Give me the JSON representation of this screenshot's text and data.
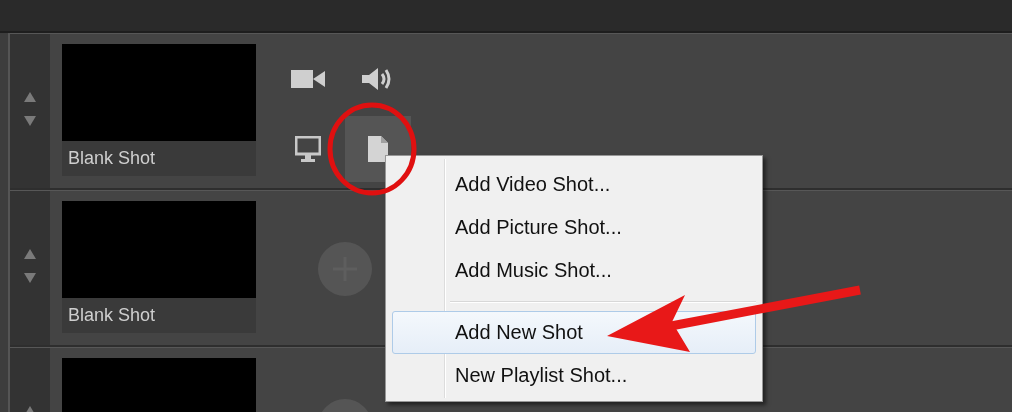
{
  "shots": [
    {
      "label": "Blank Shot",
      "kind": "media",
      "media_buttons": [
        {
          "kind": "camera",
          "selected": false
        },
        {
          "kind": "speaker",
          "selected": false
        },
        {
          "kind": "monitor",
          "selected": false
        },
        {
          "kind": "document",
          "selected": true
        }
      ]
    },
    {
      "label": "Blank Shot",
      "kind": "add"
    },
    {
      "kind": "add"
    }
  ],
  "context_menu": {
    "groups": [
      [
        {
          "label": "Add Video Shot...",
          "selected": false
        },
        {
          "label": "Add Picture Shot...",
          "selected": false
        },
        {
          "label": "Add Music Shot...",
          "selected": false
        }
      ],
      [
        {
          "label": "Add New Shot",
          "selected": true
        },
        {
          "label": "New Playlist Shot...",
          "selected": false
        }
      ]
    ]
  }
}
